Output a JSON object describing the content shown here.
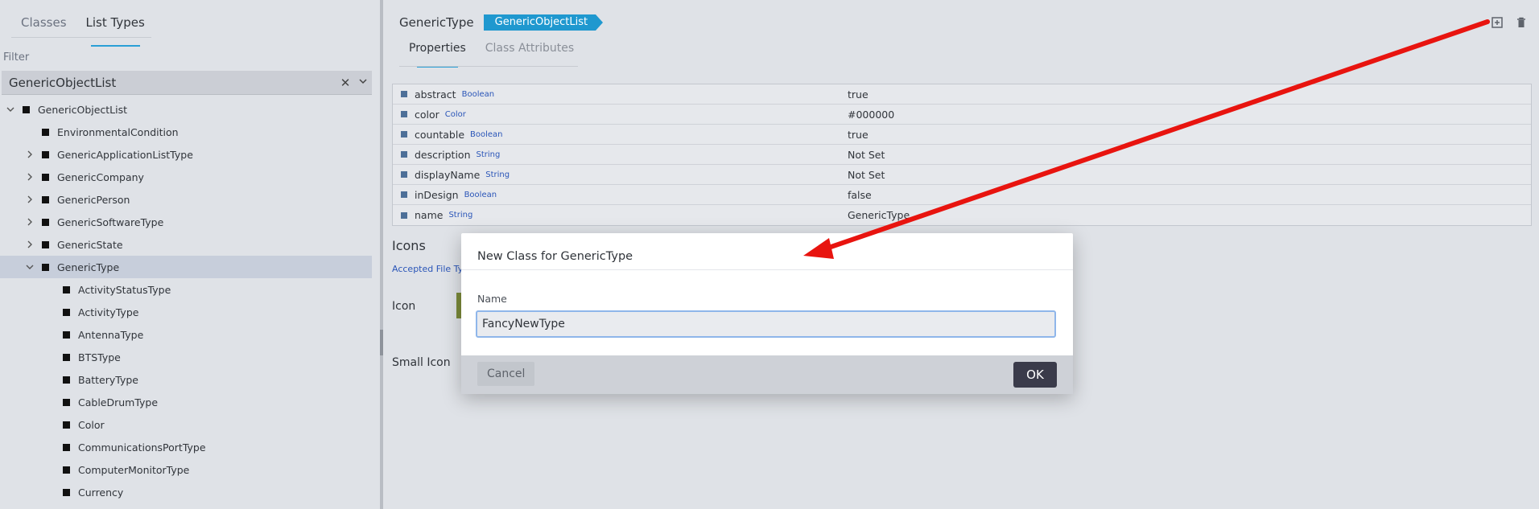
{
  "left_panel": {
    "tabs": [
      {
        "label": "Classes",
        "active": false
      },
      {
        "label": "List Types",
        "active": true
      }
    ],
    "filter": {
      "label": "Filter",
      "value": "GenericObjectList"
    },
    "tree": [
      {
        "label": "GenericObjectList",
        "level": 0,
        "toggle": "expanded",
        "selected": false
      },
      {
        "label": "EnvironmentalCondition",
        "level": 1,
        "toggle": "none",
        "selected": false
      },
      {
        "label": "GenericApplicationListType",
        "level": 1,
        "toggle": "collapsed",
        "selected": false
      },
      {
        "label": "GenericCompany",
        "level": 1,
        "toggle": "collapsed",
        "selected": false
      },
      {
        "label": "GenericPerson",
        "level": 1,
        "toggle": "collapsed",
        "selected": false
      },
      {
        "label": "GenericSoftwareType",
        "level": 1,
        "toggle": "collapsed",
        "selected": false
      },
      {
        "label": "GenericState",
        "level": 1,
        "toggle": "collapsed",
        "selected": false
      },
      {
        "label": "GenericType",
        "level": 1,
        "toggle": "expanded",
        "selected": true
      },
      {
        "label": "ActivityStatusType",
        "level": 2,
        "toggle": "none",
        "selected": false
      },
      {
        "label": "ActivityType",
        "level": 2,
        "toggle": "none",
        "selected": false
      },
      {
        "label": "AntennaType",
        "level": 2,
        "toggle": "none",
        "selected": false
      },
      {
        "label": "BTSType",
        "level": 2,
        "toggle": "none",
        "selected": false
      },
      {
        "label": "BatteryType",
        "level": 2,
        "toggle": "none",
        "selected": false
      },
      {
        "label": "CableDrumType",
        "level": 2,
        "toggle": "none",
        "selected": false
      },
      {
        "label": "Color",
        "level": 2,
        "toggle": "none",
        "selected": false
      },
      {
        "label": "CommunicationsPortType",
        "level": 2,
        "toggle": "none",
        "selected": false
      },
      {
        "label": "ComputerMonitorType",
        "level": 2,
        "toggle": "none",
        "selected": false
      },
      {
        "label": "Currency",
        "level": 2,
        "toggle": "none",
        "selected": false
      }
    ]
  },
  "right_panel": {
    "title": "GenericType",
    "parent_pill": "GenericObjectList",
    "tabs": [
      {
        "label": "Properties",
        "active": true
      },
      {
        "label": "Class Attributes",
        "active": false
      }
    ],
    "actions": [
      "add-class-icon",
      "trash-icon"
    ],
    "properties": [
      {
        "name": "abstract",
        "type": "Boolean",
        "value": "true"
      },
      {
        "name": "color",
        "type": "Color",
        "value": "#000000"
      },
      {
        "name": "countable",
        "type": "Boolean",
        "value": "true"
      },
      {
        "name": "description",
        "type": "String",
        "value": "Not Set"
      },
      {
        "name": "displayName",
        "type": "String",
        "value": "Not Set"
      },
      {
        "name": "inDesign",
        "type": "Boolean",
        "value": "false"
      },
      {
        "name": "name",
        "type": "String",
        "value": "GenericType"
      }
    ],
    "icons_section": {
      "heading": "Icons",
      "accepted_label": "Accepted File Typ",
      "icon_label": "Icon",
      "small_icon_label": "Small Icon"
    }
  },
  "dialog": {
    "title": "New Class for GenericType",
    "name_label": "Name",
    "name_value": "FancyNewType",
    "cancel_label": "Cancel",
    "ok_label": "OK"
  },
  "colors": {
    "accent": "#2a9fd6",
    "pill": "#1f98cf",
    "ok_button": "#3a3b4a",
    "annotation_arrow": "#e8140f"
  }
}
